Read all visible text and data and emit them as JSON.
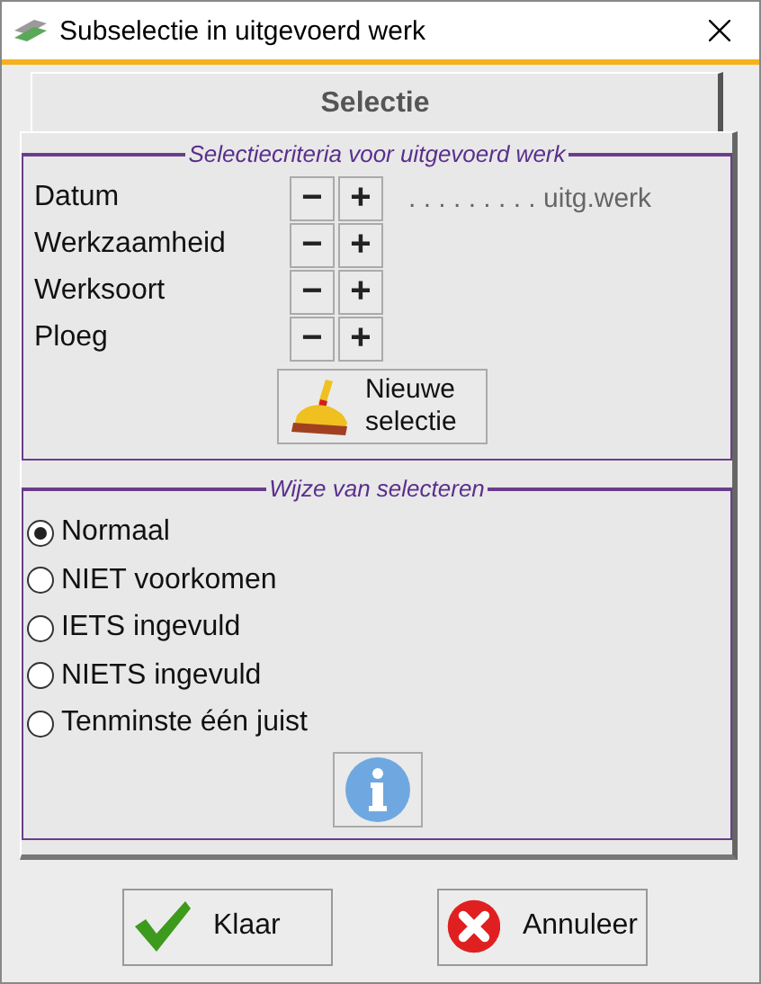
{
  "window": {
    "title": "Subselectie in uitgevoerd werk"
  },
  "tabs": [
    {
      "label": "Selectie",
      "selected": true
    }
  ],
  "criteria": {
    "legend": "Selectiecriteria voor uitgevoerd werk",
    "rows": [
      {
        "label": "Datum",
        "minus": "−",
        "plus": "+",
        "value": ". . . . . . . . . uitg.werk"
      },
      {
        "label": "Werkzaamheid",
        "minus": "−",
        "plus": "+"
      },
      {
        "label": "Werksoort",
        "minus": "−",
        "plus": "+"
      },
      {
        "label": "Ploeg",
        "minus": "−",
        "plus": "+"
      }
    ],
    "new_button": "Nieuwe selectie"
  },
  "mode": {
    "legend": "Wijze van selecteren",
    "options": [
      {
        "label": "Normaal",
        "selected": true
      },
      {
        "label": "NIET voorkomen",
        "selected": false
      },
      {
        "label": "IETS ingevuld",
        "selected": false
      },
      {
        "label": "NIETS ingevuld",
        "selected": false
      },
      {
        "label": "Tenminste één juist",
        "selected": false
      }
    ]
  },
  "buttons": [
    {
      "kind": "ok",
      "label": "Klaar"
    },
    {
      "kind": "cancel",
      "label": "Annuleer"
    }
  ]
}
